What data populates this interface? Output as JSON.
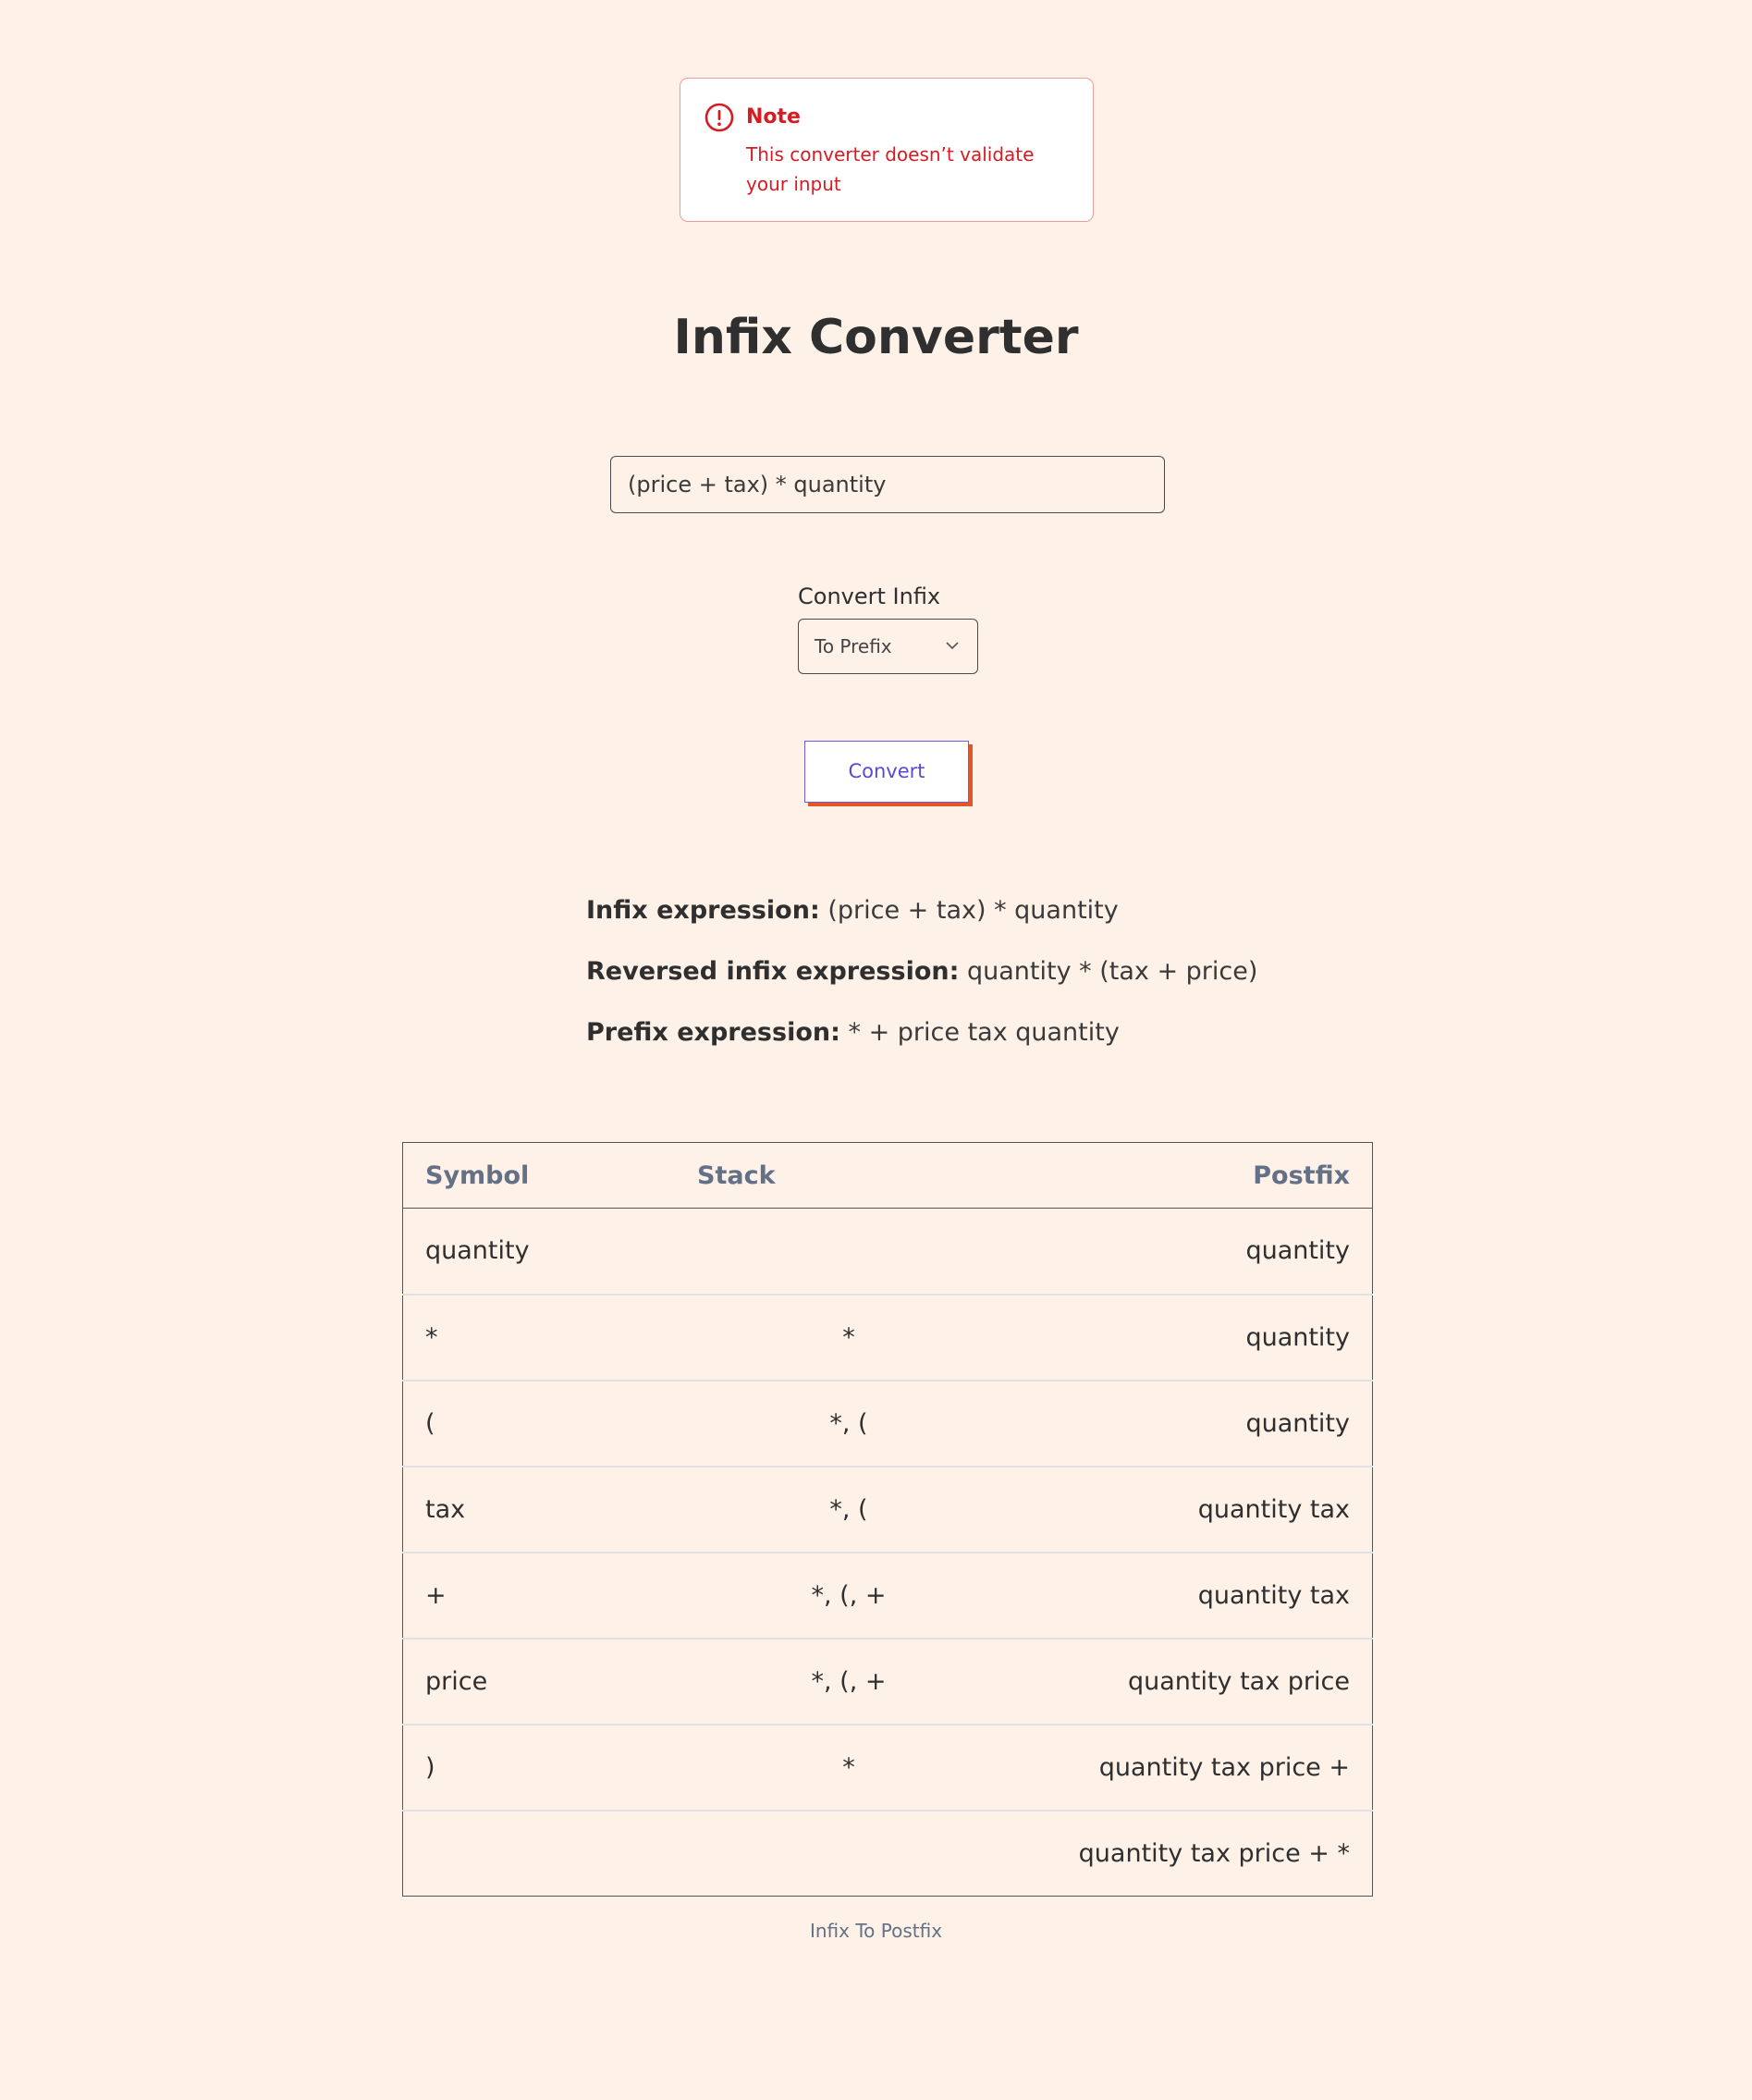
{
  "note": {
    "icon": "alert-circle-icon",
    "title": "Note",
    "text": "This converter doesn’t validate your input",
    "color": "#d81b22"
  },
  "page_title": "Infix Converter",
  "expression_input": {
    "value": "(price + tax) * quantity"
  },
  "convert_select": {
    "label": "Convert Infix",
    "selected": "To Prefix",
    "icon": "chevron-down-icon"
  },
  "convert_button": {
    "label": "Convert",
    "accent": "#5b49d6",
    "shadow": "#e4562a"
  },
  "results": {
    "infix_label": "Infix expression:",
    "infix_value": "(price + tax) * quantity",
    "reversed_label": "Reversed infix expression:",
    "reversed_value": "quantity * (tax + price)",
    "prefix_label": "Prefix expression:",
    "prefix_value": "* + price tax quantity"
  },
  "table": {
    "headers": [
      "Symbol",
      "Stack",
      "Postfix"
    ],
    "rows": [
      {
        "symbol": "quantity",
        "stack": "",
        "postfix": "quantity"
      },
      {
        "symbol": "*",
        "stack": "*",
        "postfix": "quantity"
      },
      {
        "symbol": "(",
        "stack": "*, (",
        "postfix": "quantity"
      },
      {
        "symbol": "tax",
        "stack": "*, (",
        "postfix": "quantity tax"
      },
      {
        "symbol": "+",
        "stack": "*, (, +",
        "postfix": "quantity tax"
      },
      {
        "symbol": "price",
        "stack": "*, (, +",
        "postfix": "quantity tax price"
      },
      {
        "symbol": ")",
        "stack": "*",
        "postfix": "quantity tax price +"
      },
      {
        "symbol": "",
        "stack": "",
        "postfix": "quantity tax price + *"
      }
    ],
    "caption": "Infix To Postfix"
  }
}
